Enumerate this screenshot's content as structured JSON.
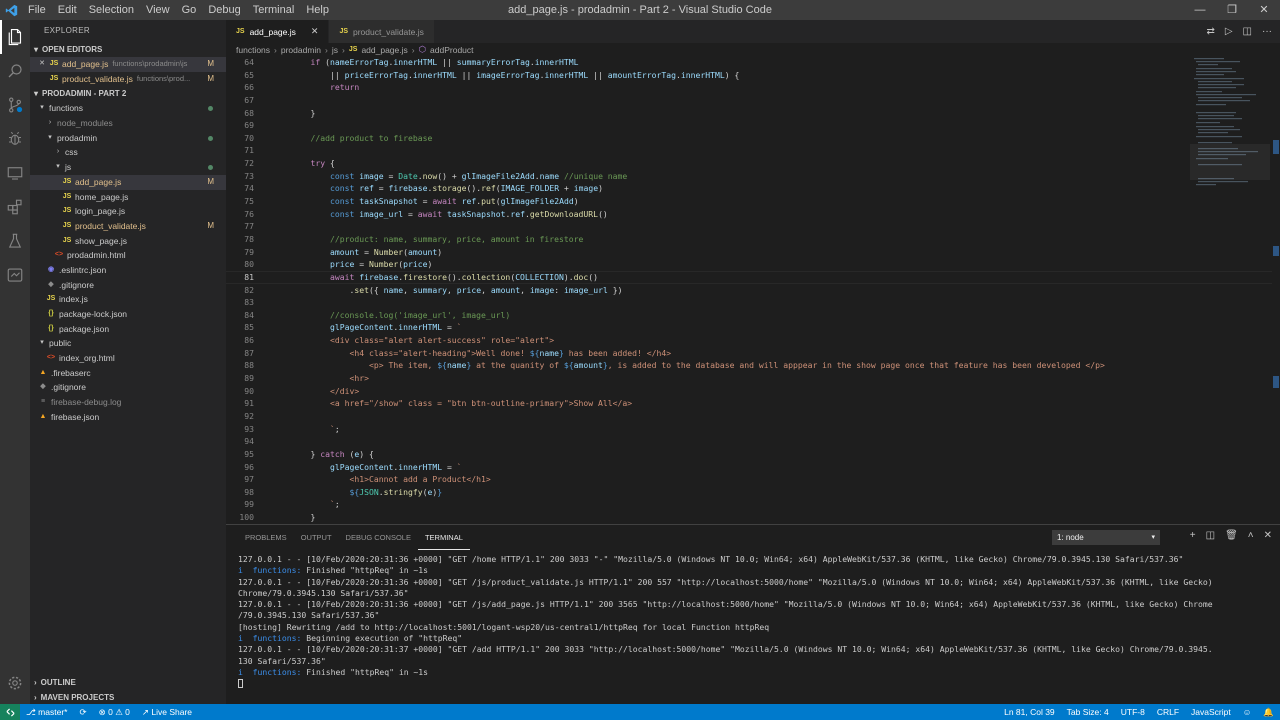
{
  "window": {
    "title": "add_page.js - prodadmin - Part 2 - Visual Studio Code",
    "menu": [
      "File",
      "Edit",
      "Selection",
      "View",
      "Go",
      "Debug",
      "Terminal",
      "Help"
    ],
    "controls": [
      "—",
      "❐",
      "✕"
    ]
  },
  "sidebar": {
    "header": "EXPLORER",
    "open_editors_label": "OPEN EDITORS",
    "open_editors": [
      {
        "name": "add_page.js",
        "desc": "functions\\prodadmin\\js",
        "badge": "M"
      },
      {
        "name": "product_validate.js",
        "desc": "functions\\prod...",
        "badge": "M"
      }
    ],
    "project_label": "PRODADMIN - PART 2",
    "tree": [
      {
        "name": "functions",
        "type": "folder-open"
      },
      {
        "name": "node_modules",
        "type": "folder-closed"
      },
      {
        "name": "prodadmin",
        "type": "folder-open"
      },
      {
        "name": "css",
        "type": "folder-closed"
      },
      {
        "name": "js",
        "type": "folder-open"
      },
      {
        "name": "add_page.js",
        "type": "js",
        "badge": "M"
      },
      {
        "name": "home_page.js",
        "type": "js"
      },
      {
        "name": "login_page.js",
        "type": "js"
      },
      {
        "name": "product_validate.js",
        "type": "js",
        "badge": "M"
      },
      {
        "name": "show_page.js",
        "type": "js"
      },
      {
        "name": "prodadmin.html",
        "type": "html"
      },
      {
        "name": ".eslintrc.json",
        "type": "eslint"
      },
      {
        "name": ".gitignore",
        "type": "git"
      },
      {
        "name": "index.js",
        "type": "js"
      },
      {
        "name": "package-lock.json",
        "type": "json"
      },
      {
        "name": "package.json",
        "type": "json"
      },
      {
        "name": "public",
        "type": "folder-open"
      },
      {
        "name": "index_org.html",
        "type": "html"
      },
      {
        "name": ".firebaserc",
        "type": "fire"
      },
      {
        "name": ".gitignore",
        "type": "git"
      },
      {
        "name": "firebase-debug.log",
        "type": "log"
      },
      {
        "name": "firebase.json",
        "type": "fire"
      }
    ],
    "outline_label": "OUTLINE",
    "maven_label": "MAVEN PROJECTS"
  },
  "tabs": [
    {
      "label": "add_page.js",
      "active": true
    },
    {
      "label": "product_validate.js",
      "active": false
    }
  ],
  "breadcrumb": [
    "functions",
    "prodadmin",
    "js",
    "add_page.js",
    "addProduct"
  ],
  "editor": {
    "current_line": 81,
    "lines": [
      {
        "n": 64,
        "html": "    <span class=\"kc\">if</span> (<span class=\"v\">nameErrorTag</span>.<span class=\"v\">innerHTML</span> || <span class=\"v\">summaryErrorTag</span>.<span class=\"v\">innerHTML</span>"
      },
      {
        "n": 65,
        "html": "        || <span class=\"v\">priceErrorTag</span>.<span class=\"v\">innerHTML</span> || <span class=\"v\">imageErrorTag</span>.<span class=\"v\">innerHTML</span> || <span class=\"v\">amountErrorTag</span>.<span class=\"v\">innerHTML</span>) {"
      },
      {
        "n": 66,
        "html": "        <span class=\"kc\">return</span>"
      },
      {
        "n": 67,
        "html": ""
      },
      {
        "n": 68,
        "html": "    }"
      },
      {
        "n": 69,
        "html": ""
      },
      {
        "n": 70,
        "html": "    <span class=\"cm\">//add product to firebase</span>"
      },
      {
        "n": 71,
        "html": ""
      },
      {
        "n": 72,
        "html": "    <span class=\"kc\">try</span> {"
      },
      {
        "n": 73,
        "html": "        <span class=\"k\">const</span> <span class=\"v\">image</span> = <span class=\"ty\">Date</span>.<span class=\"f\">now</span>() + <span class=\"v\">glImageFile2Add</span>.<span class=\"v\">name</span> <span class=\"cm\">//unique name</span>"
      },
      {
        "n": 74,
        "html": "        <span class=\"k\">const</span> <span class=\"v\">ref</span> = <span class=\"v\">firebase</span>.<span class=\"f\">storage</span>().<span class=\"f\">ref</span>(<span class=\"v\">IMAGE_FOLDER</span> + <span class=\"v\">image</span>)"
      },
      {
        "n": 75,
        "html": "        <span class=\"k\">const</span> <span class=\"v\">taskSnapshot</span> = <span class=\"kc\">await</span> <span class=\"v\">ref</span>.<span class=\"f\">put</span>(<span class=\"v\">glImageFile2Add</span>)"
      },
      {
        "n": 76,
        "html": "        <span class=\"k\">const</span> <span class=\"v\">image_url</span> = <span class=\"kc\">await</span> <span class=\"v\">taskSnapshot</span>.<span class=\"v\">ref</span>.<span class=\"f\">getDownloadURL</span>()"
      },
      {
        "n": 77,
        "html": ""
      },
      {
        "n": 78,
        "html": "        <span class=\"cm\">//product: name, summary, price, amount in firestore</span>"
      },
      {
        "n": 79,
        "html": "        <span class=\"v\">amount</span> = <span class=\"f\">Number</span>(<span class=\"v\">amount</span>)"
      },
      {
        "n": 80,
        "html": "        <span class=\"v\">price</span> = <span class=\"f\">Number</span>(<span class=\"v\">price</span>)"
      },
      {
        "n": 81,
        "html": "        <span class=\"kc\">await</span> <span class=\"v\">firebase</span>.<span class=\"f\">firestore</span>().<span class=\"f\">collection</span>(<span class=\"v\">COLLECTION</span>).<span class=\"f\">doc</span>()"
      },
      {
        "n": 82,
        "html": "            .<span class=\"f\">set</span>({ <span class=\"v\">name</span>, <span class=\"v\">summary</span>, <span class=\"v\">price</span>, <span class=\"v\">amount</span>, <span class=\"v\">image</span>: <span class=\"v\">image_url</span> })"
      },
      {
        "n": 83,
        "html": ""
      },
      {
        "n": 84,
        "html": "        <span class=\"cm\">//console.log('image_url', image_url)</span>"
      },
      {
        "n": 85,
        "html": "        <span class=\"v\">glPageContent</span>.<span class=\"v\">innerHTML</span> = <span class=\"s\">`</span>"
      },
      {
        "n": 86,
        "html": "<span class=\"s\">        &lt;div class=\"alert alert-success\" role=\"alert\"&gt;</span>"
      },
      {
        "n": 87,
        "html": "<span class=\"s\">            &lt;h4 class=\"alert-heading\"&gt;Well done! </span><span class=\"ds\">${</span><span class=\"v\">name</span><span class=\"ds\">}</span><span class=\"s\"> has been added! &lt;/h4&gt;</span>"
      },
      {
        "n": 88,
        "html": "<span class=\"s\">                &lt;p&gt; The item, </span><span class=\"ds\">${</span><span class=\"v\">name</span><span class=\"ds\">}</span><span class=\"s\"> at the quanity of </span><span class=\"ds\">${</span><span class=\"v\">amount</span><span class=\"ds\">}</span><span class=\"s\">, is added to the database and will apppear in the show page once that feature has been developed &lt;/p&gt;</span>"
      },
      {
        "n": 89,
        "html": "<span class=\"s\">            &lt;hr&gt;</span>"
      },
      {
        "n": 90,
        "html": "<span class=\"s\">        &lt;/div&gt;</span>"
      },
      {
        "n": 91,
        "html": "<span class=\"s\">        &lt;a href=\"/show\" class = \"btn btn-outline-primary\"&gt;Show All&lt;/a&gt;</span>"
      },
      {
        "n": 92,
        "html": ""
      },
      {
        "n": 93,
        "html": "<span class=\"s\">        `</span>;"
      },
      {
        "n": 94,
        "html": ""
      },
      {
        "n": 95,
        "html": "    } <span class=\"kc\">catch</span> (<span class=\"v\">e</span>) {"
      },
      {
        "n": 96,
        "html": "        <span class=\"v\">glPageContent</span>.<span class=\"v\">innerHTML</span> = <span class=\"s\">`</span>"
      },
      {
        "n": 97,
        "html": "<span class=\"s\">            &lt;h1&gt;Cannot add a Product&lt;/h1&gt;</span>"
      },
      {
        "n": 98,
        "html": "<span class=\"s\">            </span><span class=\"ds\">${</span><span class=\"ty\">JSON</span>.<span class=\"f\">stringfy</span>(<span class=\"v\">e</span>)<span class=\"ds\">}</span>"
      },
      {
        "n": 99,
        "html": "<span class=\"s\">        `</span>;"
      },
      {
        "n": 100,
        "html": "    }"
      }
    ]
  },
  "panel": {
    "tabs": [
      "PROBLEMS",
      "OUTPUT",
      "DEBUG CONSOLE",
      "TERMINAL"
    ],
    "active_tab": "TERMINAL",
    "terminal_select": "1: node",
    "terminal_lines": [
      {
        "kind": "plain",
        "text": "127.0.0.1 - - [10/Feb/2020:20:31:36 +0000] \"GET /home HTTP/1.1\" 200 3033 \"-\" \"Mozilla/5.0 (Windows NT 10.0; Win64; x64) AppleWebKit/537.36 (KHTML, like Gecko) Chrome/79.0.3945.130 Safari/537.36\""
      },
      {
        "kind": "info",
        "label": "functions:",
        "text": " Finished \"httpReq\" in ~1s"
      },
      {
        "kind": "plain",
        "text": "127.0.0.1 - - [10/Feb/2020:20:31:36 +0000] \"GET /js/product_validate.js HTTP/1.1\" 200 557 \"http://localhost:5000/home\" \"Mozilla/5.0 (Windows NT 10.0; Win64; x64) AppleWebKit/537.36 (KHTML, like Gecko)"
      },
      {
        "kind": "plain",
        "text": "Chrome/79.0.3945.130 Safari/537.36\""
      },
      {
        "kind": "plain",
        "text": "127.0.0.1 - - [10/Feb/2020:20:31:36 +0000] \"GET /js/add_page.js HTTP/1.1\" 200 3565 \"http://localhost:5000/home\" \"Mozilla/5.0 (Windows NT 10.0; Win64; x64) AppleWebKit/537.36 (KHTML, like Gecko) Chrome"
      },
      {
        "kind": "plain",
        "text": "/79.0.3945.130 Safari/537.36\""
      },
      {
        "kind": "plain",
        "text": "[hosting] Rewriting /add to http://localhost:5001/logant-wsp20/us-central1/httpReq for local Function httpReq"
      },
      {
        "kind": "info",
        "label": "functions:",
        "text": " Beginning execution of \"httpReq\""
      },
      {
        "kind": "plain",
        "text": "127.0.0.1 - - [10/Feb/2020:20:31:37 +0000] \"GET /add HTTP/1.1\" 200 3033 \"http://localhost:5000/home\" \"Mozilla/5.0 (Windows NT 10.0; Win64; x64) AppleWebKit/537.36 (KHTML, like Gecko) Chrome/79.0.3945."
      },
      {
        "kind": "plain",
        "text": "130 Safari/537.36\""
      },
      {
        "kind": "info",
        "label": "functions:",
        "text": " Finished \"httpReq\" in ~1s"
      }
    ]
  },
  "status": {
    "branch": "master*",
    "errors": "0",
    "warnings": "0",
    "live_share": "Live Share",
    "position": "Ln 81, Col 39",
    "tab_size": "Tab Size: 4",
    "encoding": "UTF-8",
    "eol": "CRLF",
    "language": "JavaScript"
  },
  "colors": {
    "accent": "#007acc",
    "activity_bar": "#333333",
    "sidebar": "#252526",
    "editor": "#1e1e1e"
  }
}
